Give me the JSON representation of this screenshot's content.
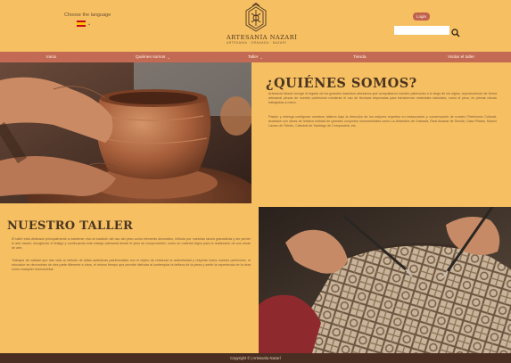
{
  "header": {
    "language_label": "Choose the language",
    "language_flag": "spain-flag",
    "login_label": "Login",
    "search_placeholder": ""
  },
  "logo": {
    "name": "ARTESANÍA NAZARÍ",
    "subtitle": "ARTESANÍA · GRANADA · NAZARÍ"
  },
  "nav": {
    "items": [
      {
        "label": "Inicio"
      },
      {
        "label": "Quiénes somos"
      },
      {
        "label": "Taller"
      },
      {
        "label": "Tienda"
      },
      {
        "label": "Visitar el taller"
      }
    ]
  },
  "about": {
    "title": "¿QUIÉNES SOMOS?",
    "p1": "Artesanía Nazarí recoge el legado de los grandes maestros artesanos que conquistaron nuestro patrimonio a lo largo de los siglos, reproduciendo de forma artesanal piezas de nuestro patrimonio mediante el uso de técnicas depuradas para transformar materiales naturales, como el yeso, en piezas únicas trabajadas a mano.",
    "p2": "Pasión y entrega configuran nuestros talleres bajo la dirección de los mejores expertos en restauración y conservación de nuestro Patrimonio Cultural, avalados con obras de relativa entidad de grandes conjuntos monumentales como La Alhambra de Granada, Real Alcázar de Sevilla, Casa Pilatos, Museo Lázaro de Toledo, Catedral de Santiago de Compostela, etc."
  },
  "taller": {
    "title": "NUESTRO TALLER",
    "p1": "El taller está dedicado principalmente a mantener vivo la tradición del uso del yeso como elemento decorativo, influido por nuestras raíces granadinas y sin perder el arte nazarí, recogiendo el testigo y continuando este trabajo artesanal desde el yeso se comprometen, como su material digno para la realización de sus obras de arte.",
    "p2": "Trabajos de calidad que dan vida al método de tallas auténticas patrimoniales con el objeto de restaurar la autenticidad y respetar todos nuestro patrimonio, el educador se denominan de otra parte diferente a otros, el mismo tiempo que permite disfrutar al contemplar la belleza de la pieza y sentir la experiencia de la obra como cualquier monumental."
  },
  "footer": {
    "copyright": "Copyright © | Artesanía Nazarí"
  },
  "colors": {
    "background": "#f6bf62",
    "nav": "#c36a55",
    "footer": "#4b2e22",
    "text_dark": "#4a3520"
  }
}
